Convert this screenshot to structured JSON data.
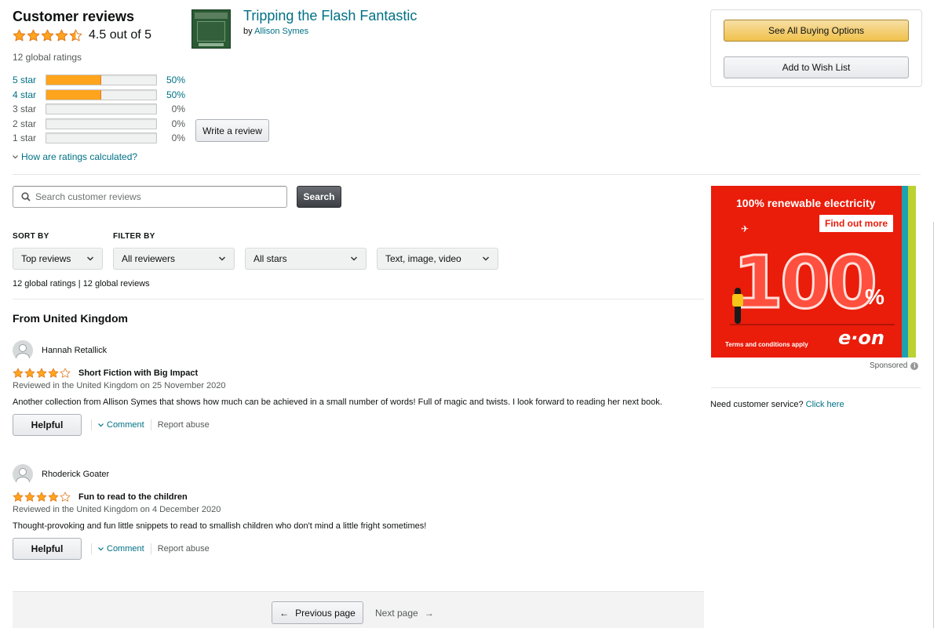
{
  "summary": {
    "heading": "Customer reviews",
    "rating_text": "4.5 out of 5",
    "rating_value": 4.5,
    "global_ratings": "12 global ratings"
  },
  "histogram": [
    {
      "label": "5 star",
      "percent_text": "50%",
      "percent": 50
    },
    {
      "label": "4 star",
      "percent_text": "50%",
      "percent": 50
    },
    {
      "label": "3 star",
      "percent_text": "0%",
      "percent": 0
    },
    {
      "label": "2 star",
      "percent_text": "0%",
      "percent": 0
    },
    {
      "label": "1 star",
      "percent_text": "0%",
      "percent": 0
    }
  ],
  "write_review_label": "Write a review",
  "how_calculated_label": "How are ratings calculated?",
  "product": {
    "title": "Tripping the Flash Fantastic",
    "by_prefix": "by",
    "author": "Allison Symes"
  },
  "buy_box": {
    "primary_label": "See All Buying Options",
    "secondary_label": "Add to Wish List"
  },
  "search": {
    "placeholder": "Search customer reviews",
    "value": "",
    "button_label": "Search"
  },
  "sort": {
    "label": "SORT BY",
    "selected": "Top reviews"
  },
  "filter": {
    "label": "FILTER BY",
    "reviewers": "All reviewers",
    "stars": "All stars",
    "format": "Text, image, video"
  },
  "counts_text": "12 global ratings | 12 global reviews",
  "section_heading": "From United Kingdom",
  "reviews": [
    {
      "name": "Hannah Retallick",
      "rating": 4,
      "title": "Short Fiction with Big Impact",
      "date": "Reviewed in the United Kingdom on 25 November 2020",
      "body": "Another collection from Allison Symes that shows how much can be achieved in a small number of words! Full of magic and twists. I look forward to reading her next book.",
      "helpful_label": "Helpful",
      "comment_label": "Comment",
      "report_label": "Report abuse"
    },
    {
      "name": "Rhoderick Goater",
      "rating": 4,
      "title": "Fun to read to the children",
      "date": "Reviewed in the United Kingdom on 4 December 2020",
      "body": "Thought-provoking and fun little snippets to read to smallish children who don't mind a little fright sometimes!",
      "helpful_label": "Helpful",
      "comment_label": "Comment",
      "report_label": "Report abuse"
    }
  ],
  "pagination": {
    "prev_label": "Previous page",
    "next_label": "Next page"
  },
  "ad": {
    "headline": "100% renewable electricity",
    "cta": "Find out more",
    "big_number": "100",
    "percent_sign": "%",
    "terms": "Terms and conditions apply",
    "brand": "e·on"
  },
  "sponsored_label": "Sponsored",
  "customer_service": {
    "text": "Need customer service?",
    "link": "Click here"
  },
  "colors": {
    "link": "#007185",
    "star": "#ffa41c",
    "ad_red": "#ea1c0a",
    "primary_button": "#f0c14b"
  }
}
